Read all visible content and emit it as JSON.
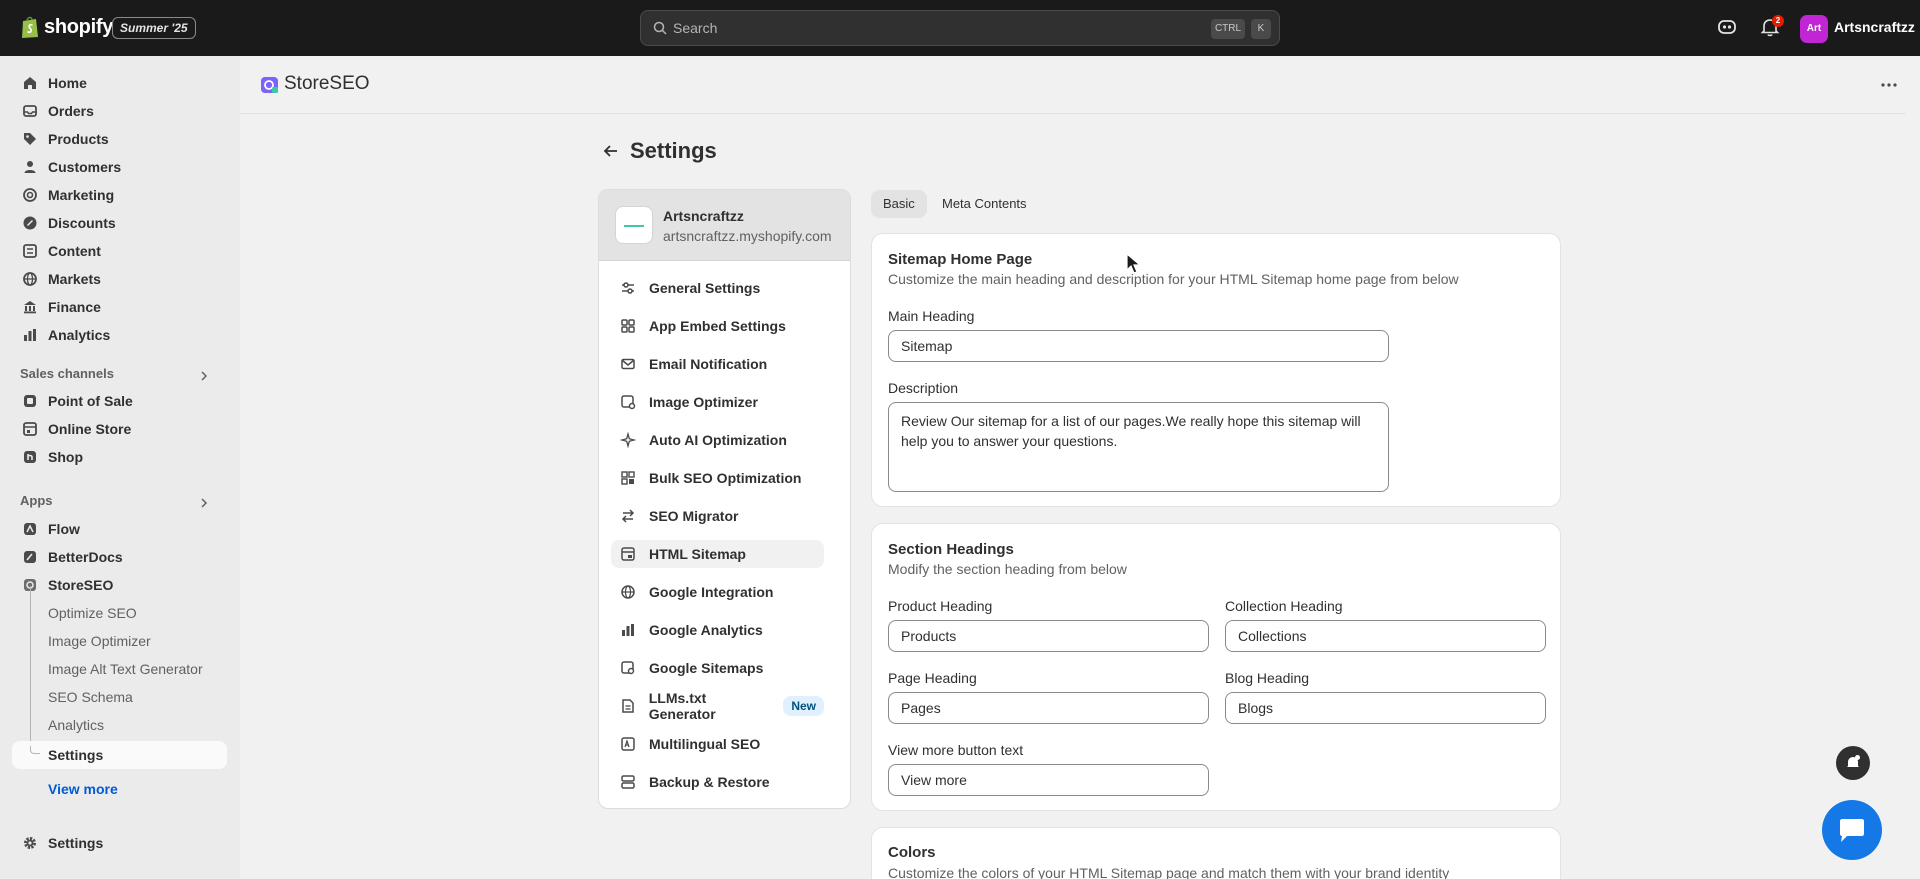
{
  "topbar": {
    "brand": "shopify",
    "edition": "Summer '25",
    "search_placeholder": "Search",
    "shortcut_ctrl": "CTRL",
    "shortcut_key": "K",
    "notification_count": "2",
    "avatar_initials": "Art",
    "store_name": "Artsncraftzz"
  },
  "sidebar": {
    "main": [
      "Home",
      "Orders",
      "Products",
      "Customers",
      "Marketing",
      "Discounts",
      "Content",
      "Markets",
      "Finance",
      "Analytics"
    ],
    "sales_channels_title": "Sales channels",
    "sales_channels": [
      "Point of Sale",
      "Online Store",
      "Shop"
    ],
    "apps_title": "Apps",
    "apps": [
      "Flow",
      "BetterDocs",
      "StoreSEO"
    ],
    "storeseo_sub": [
      "Optimize SEO",
      "Image Optimizer",
      "Image Alt Text Generator",
      "SEO Schema",
      "Analytics",
      "Settings"
    ],
    "view_more": "View more",
    "settings": "Settings"
  },
  "app": {
    "title": "StoreSEO",
    "page_title": "Settings"
  },
  "settings_nav": {
    "store_name": "Artsncraftzz",
    "store_url": "artsncraftzz.myshopify.com",
    "items": [
      "General Settings",
      "App Embed Settings",
      "Email Notification",
      "Image Optimizer",
      "Auto AI Optimization",
      "Bulk SEO Optimization",
      "SEO Migrator",
      "HTML Sitemap",
      "Google Integration",
      "Google Analytics",
      "Google Sitemaps",
      "LLMs.txt Generator",
      "Multilingual SEO",
      "Backup & Restore"
    ],
    "new_badge": "New",
    "active_item": "HTML Sitemap"
  },
  "tabs": [
    "Basic",
    "Meta Contents"
  ],
  "sitemap_home": {
    "title": "Sitemap Home Page",
    "subtitle": "Customize the main heading and description for your HTML Sitemap home page from below",
    "main_heading_label": "Main Heading",
    "main_heading_value": "Sitemap",
    "description_label": "Description",
    "description_value": "Review Our sitemap for a list of our pages.We really hope this sitemap will help you to answer your questions."
  },
  "section_headings": {
    "title": "Section Headings",
    "subtitle": "Modify the section heading from below",
    "product_label": "Product Heading",
    "product_value": "Products",
    "collection_label": "Collection Heading",
    "collection_value": "Collections",
    "page_label": "Page Heading",
    "page_value": "Pages",
    "blog_label": "Blog Heading",
    "blog_value": "Blogs",
    "view_more_label": "View more button text",
    "view_more_value": "View more"
  },
  "colors": {
    "title": "Colors",
    "subtitle": "Customize the colors of your HTML Sitemap page and match them with your brand identity"
  },
  "theme": {
    "topbar_bg": "#1a1a1a",
    "accent_link": "#005bd3",
    "chat_fab": "#1479e6"
  }
}
